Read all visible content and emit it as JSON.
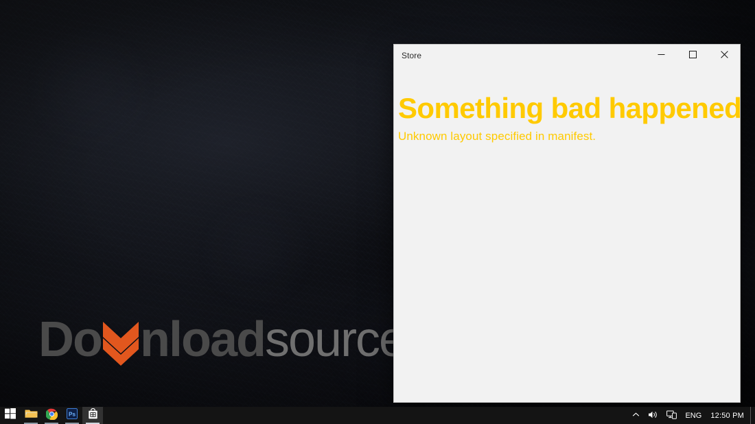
{
  "desktop": {
    "wallpaper_name": "dark-grunge-texture",
    "watermark": {
      "text_primary": "Do",
      "text_chevron_icon": "double-chevron-down-icon",
      "text_middle": "nload",
      "text_secondary": "source",
      "color_primary": "#4a4a4a",
      "color_secondary": "#6f6f6f",
      "color_accent": "#e2571e"
    }
  },
  "window": {
    "title": "Store",
    "controls": {
      "minimize_label": "Minimize",
      "minimize_icon": "minimize-icon",
      "maximize_label": "Maximize",
      "maximize_icon": "maximize-icon",
      "close_label": "Close",
      "close_icon": "close-icon"
    },
    "content": {
      "headline": "Something bad happened",
      "subtext": "Unknown layout specified in manifest.",
      "accent_color": "#ffca00",
      "background_color": "#f2f2f2"
    }
  },
  "taskbar": {
    "background_color": "#141414",
    "buttons": [
      {
        "name": "start-button",
        "label": "Start",
        "icon": "windows-logo-icon",
        "running": false,
        "active": false
      },
      {
        "name": "file-explorer-button",
        "label": "File Explorer",
        "icon": "folder-icon",
        "running": true,
        "active": false
      },
      {
        "name": "chrome-button",
        "label": "Google Chrome",
        "icon": "chrome-icon",
        "running": true,
        "active": false
      },
      {
        "name": "photoshop-button",
        "label": "Adobe Photoshop",
        "icon": "photoshop-icon",
        "running": true,
        "active": false
      },
      {
        "name": "store-button",
        "label": "Store",
        "icon": "store-bag-icon",
        "running": true,
        "active": true
      }
    ],
    "tray": {
      "show_hidden_icons_label": "Show hidden icons",
      "show_hidden_icons_icon": "chevron-up-icon",
      "volume_label": "Volume",
      "volume_icon": "speaker-icon",
      "network_label": "Network",
      "network_icon": "network-monitor-icon",
      "language": "ENG",
      "clock": "12:50 PM",
      "show_desktop_label": "Show desktop"
    }
  }
}
